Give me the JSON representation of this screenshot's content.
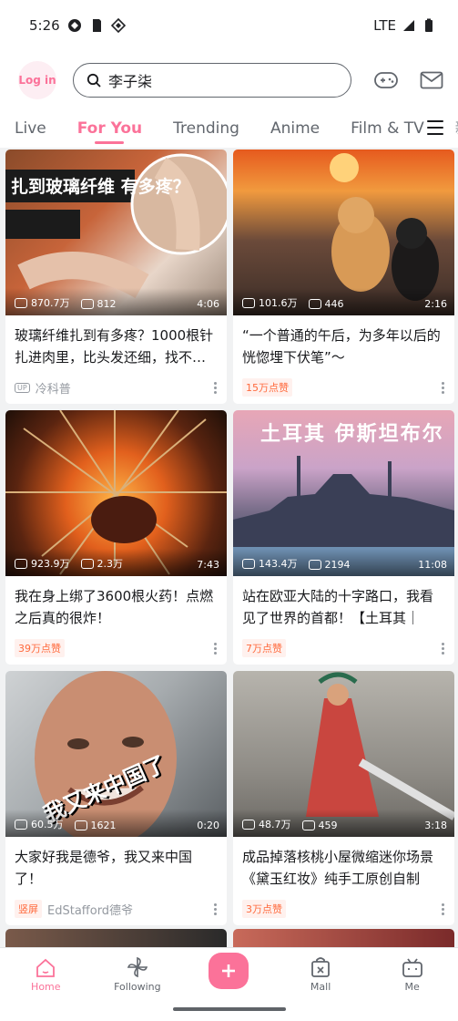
{
  "status_bar": {
    "time": "5:26",
    "network": "LTE"
  },
  "header": {
    "login_label": "Log in",
    "search_value": "李子柒"
  },
  "tabs": [
    {
      "label": "Live"
    },
    {
      "label": "For You"
    },
    {
      "label": "Trending"
    },
    {
      "label": "Anime"
    },
    {
      "label": "Film & TV"
    },
    {
      "label": "新征"
    }
  ],
  "feed": [
    {
      "title": "玻璃纤维扎到有多疼？1000根针扎进肉里，比头发还细，找不…",
      "views": "870.7万",
      "danmaku": "812",
      "duration": "4:06",
      "badge": "",
      "up_tag": "UP",
      "author": "冷科普",
      "overlay_text": "扎到玻璃纤维 有多疼？"
    },
    {
      "title": "“一个普通的午后，为多年以后的恍惚埋下伏笔”～",
      "views": "101.6万",
      "danmaku": "446",
      "duration": "2:16",
      "badge": "15万点赞",
      "up_tag": "",
      "author": "",
      "overlay_text": ""
    },
    {
      "title": "我在身上绑了3600根火药！点燃之后真的很炸！",
      "views": "923.9万",
      "danmaku": "2.3万",
      "duration": "7:43",
      "badge": "39万点赞",
      "up_tag": "",
      "author": "",
      "overlay_text": ""
    },
    {
      "title": "站在欧亚大陆的十字路口，我看见了世界的首都！【土耳其｜伊…",
      "views": "143.4万",
      "danmaku": "2194",
      "duration": "11:08",
      "badge": "7万点赞",
      "up_tag": "",
      "author": "",
      "overlay_text": "土耳其 伊斯坦布尔"
    },
    {
      "title": "大家好我是德爷，我又来中国了！",
      "views": "60.5万",
      "danmaku": "1621",
      "duration": "0:20",
      "badge": "竖屏",
      "up_tag": "",
      "author": "EdStafford德爷",
      "overlay_text": "我又来中国了"
    },
    {
      "title": "成品掉落核桃小屋微缩迷你场景《黛玉红妆》纯手工原创自制",
      "views": "48.7万",
      "danmaku": "459",
      "duration": "3:18",
      "badge": "3万点赞",
      "up_tag": "",
      "author": "",
      "overlay_text": ""
    }
  ],
  "bottom_nav": [
    {
      "label": "Home"
    },
    {
      "label": "Following"
    },
    {
      "label": ""
    },
    {
      "label": "Mall"
    },
    {
      "label": "Me"
    }
  ],
  "colors": {
    "accent": "#fb7299",
    "badge_text": "#ff6a3d",
    "badge_bg": "#fff1ee"
  }
}
